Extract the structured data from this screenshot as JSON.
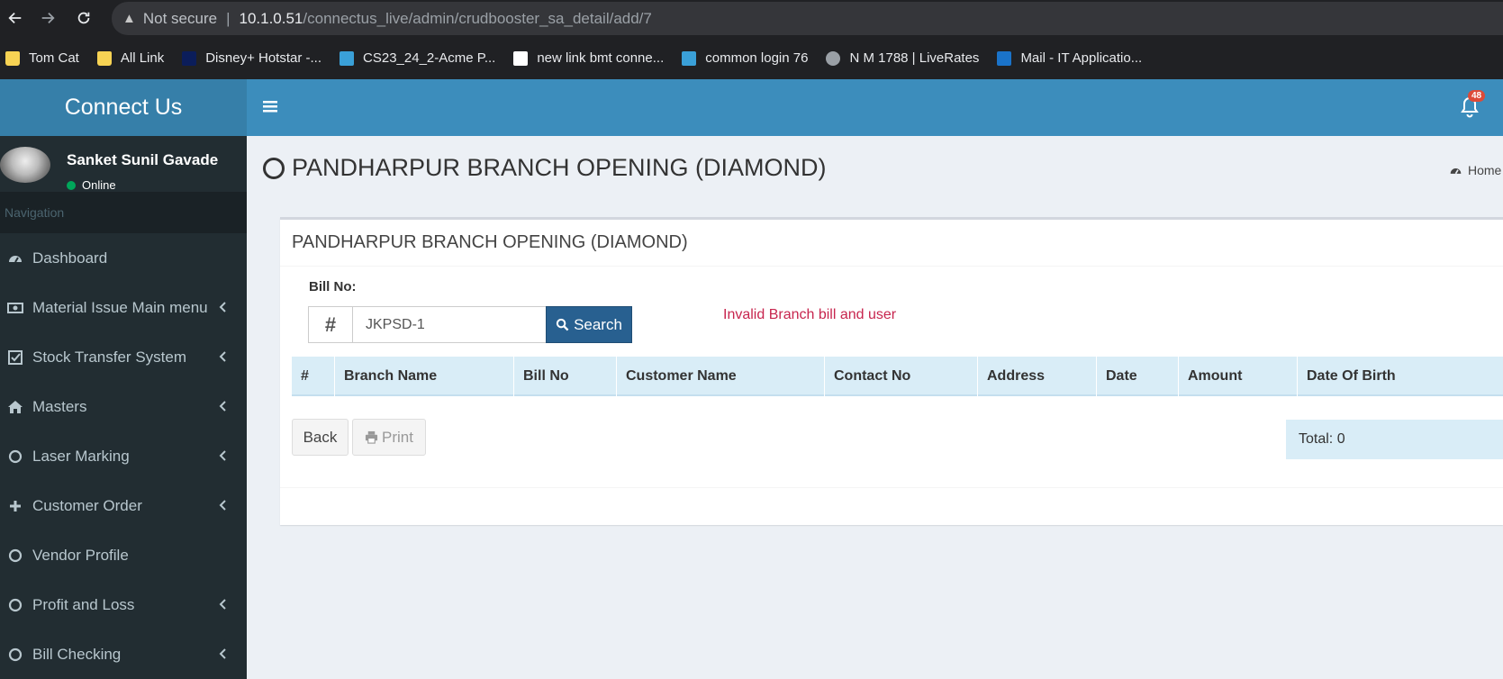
{
  "browser": {
    "security_label": "Not secure",
    "url_host": "10.1.0.51",
    "url_path": "/connectus_live/admin/crudbooster_sa_detail/add/7"
  },
  "bookmarks": [
    {
      "label": "Tom Cat",
      "icon": "folder-icon"
    },
    {
      "label": "All Link",
      "icon": "folder-icon"
    },
    {
      "label": "Disney+ Hotstar -...",
      "icon": "hotstar-icon"
    },
    {
      "label": "CS23_24_2-Acme P...",
      "icon": "app-icon"
    },
    {
      "label": "new link bmt conne...",
      "icon": "site-icon"
    },
    {
      "label": "common login 76",
      "icon": "app-icon"
    },
    {
      "label": "N M 1788 | LiveRates",
      "icon": "globe-icon"
    },
    {
      "label": "Mail - IT Applicatio...",
      "icon": "outlook-icon"
    }
  ],
  "app": {
    "logo": "Connect Us",
    "notification_count": "48",
    "accent": "#3c8dbc"
  },
  "user": {
    "name": "Sanket Sunil Gavade",
    "status": "Online"
  },
  "sidebar": {
    "header": "Navigation",
    "items": [
      {
        "label": "Dashboard",
        "icon": "dashboard-icon"
      },
      {
        "label": "Material Issue Main menu",
        "icon": "money-icon"
      },
      {
        "label": "Stock Transfer System",
        "icon": "check-square-icon"
      },
      {
        "label": "Masters",
        "icon": "home-icon"
      },
      {
        "label": "Laser Marking",
        "icon": "circle-icon"
      },
      {
        "label": "Customer Order",
        "icon": "plus-icon"
      },
      {
        "label": "Vendor Profile",
        "icon": "circle-icon"
      },
      {
        "label": "Profit and Loss",
        "icon": "circle-icon"
      },
      {
        "label": "Bill Checking",
        "icon": "circle-icon"
      }
    ]
  },
  "page": {
    "title": "PANDHARPUR BRANCH OPENING (DIAMOND)",
    "breadcrumb": "Home",
    "box_title": "PANDHARPUR BRANCH OPENING (DIAMOND)",
    "bill_label": "Bill No:",
    "bill_addon": "#",
    "bill_value": "JKPSD-1",
    "search_label": "Search",
    "error_message": "Invalid Branch bill and user",
    "columns": [
      "#",
      "Branch Name",
      "Bill No",
      "Customer Name",
      "Contact No",
      "Address",
      "Date",
      "Amount",
      "Date Of Birth"
    ],
    "back_label": "Back",
    "print_label": "Print",
    "total": "Total: 0"
  }
}
